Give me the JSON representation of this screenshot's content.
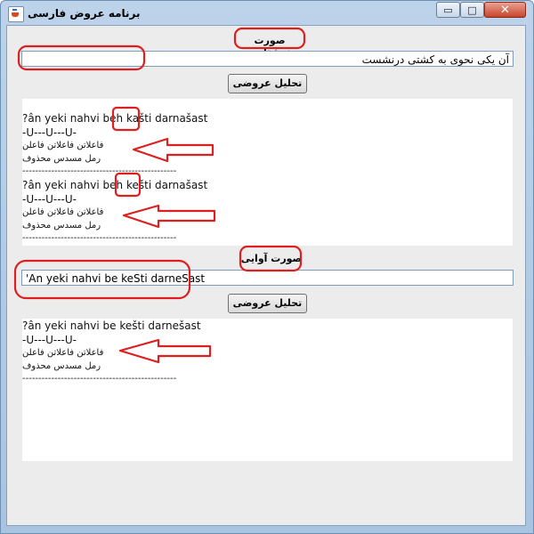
{
  "window": {
    "title": "برنامه عروض فارسی",
    "controls": {
      "minimize": "▭",
      "maximize": "□",
      "close": "✕"
    }
  },
  "written": {
    "label": "صورت نوشتاری",
    "input_value": "آن یکی نحوی به کشتی درنشست",
    "button": "تحلیل عروضی",
    "results": [
      {
        "transliteration": "?ân yeki nahvi beh kašti darnašast",
        "pattern": "-U---U---U-",
        "feet": "فاعلاتن فاعلاتن فاعلن",
        "meter": "رمل مسدس محذوف",
        "separator": "------------------------------------------------"
      },
      {
        "transliteration": "?ân yeki nahvi beh kešti darnašast",
        "pattern": "-U---U---U-",
        "feet": "فاعلاتن فاعلاتن فاعلن",
        "meter": "رمل مسدس محذوف",
        "separator": "------------------------------------------------"
      }
    ]
  },
  "phonetic": {
    "label": "صورت آوایی",
    "input_value": "'An yeki nahvi be keSti darneSast",
    "button": "تحلیل عروضی",
    "results": [
      {
        "transliteration": "?ân yeki nahvi be kešti darnešast",
        "pattern": "-U---U---U-",
        "feet": "فاعلاتن فاعلاتن فاعلن",
        "meter": "رمل مسدس محذوف",
        "separator": "------------------------------------------------"
      }
    ]
  },
  "annotations": {
    "color": "#dd1f1f"
  }
}
